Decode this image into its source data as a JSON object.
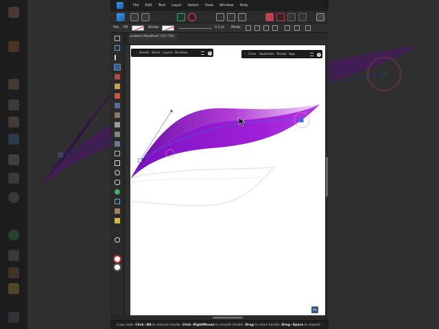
{
  "app": {
    "name": "Affinity Designer"
  },
  "menu": [
    "File",
    "Edit",
    "Text",
    "Layer",
    "Select",
    "View",
    "Window",
    "Help"
  ],
  "context_toolbar": {
    "tool_label": "Pen",
    "fill_label": "Fill",
    "stroke_label": "Stroke",
    "width_value": "0.2 pt",
    "mode_label": "Mode:"
  },
  "document": {
    "tab_title": "untitled [Modified] (157.7%)"
  },
  "left_panel": {
    "tabs": [
      "Assets",
      "Stock",
      "Layers",
      "Brushes"
    ]
  },
  "right_panel": {
    "tabs": [
      "Color",
      "Swatches",
      "Stroke",
      "App"
    ]
  },
  "status": {
    "segments": [
      {
        "text": "Cusp node. ",
        "bold": false
      },
      {
        "text": "Click",
        "bold": true
      },
      {
        "text": "+",
        "bold": false
      },
      {
        "text": "Alt",
        "bold": true
      },
      {
        "text": " to remove handle. ",
        "bold": false
      },
      {
        "text": "Click",
        "bold": true
      },
      {
        "text": "+",
        "bold": false
      },
      {
        "text": "RightMouse",
        "bold": true
      },
      {
        "text": " to smooth handle. ",
        "bold": false
      },
      {
        "text": "Drag",
        "bold": true
      },
      {
        "text": " to move handle. ",
        "bold": false
      },
      {
        "text": "Drag",
        "bold": true
      },
      {
        "text": "+",
        "bold": false
      },
      {
        "text": "Space",
        "bold": true
      },
      {
        "text": " to repositi",
        "bold": false
      }
    ]
  },
  "corner_badge": "DA",
  "colors": {
    "leaf_dark": "#6a0aa8",
    "leaf_mid": "#a020d8",
    "leaf_light": "#f0d8f6",
    "selection": "#3b6fd4",
    "accent_pink": "#f08ca8"
  }
}
